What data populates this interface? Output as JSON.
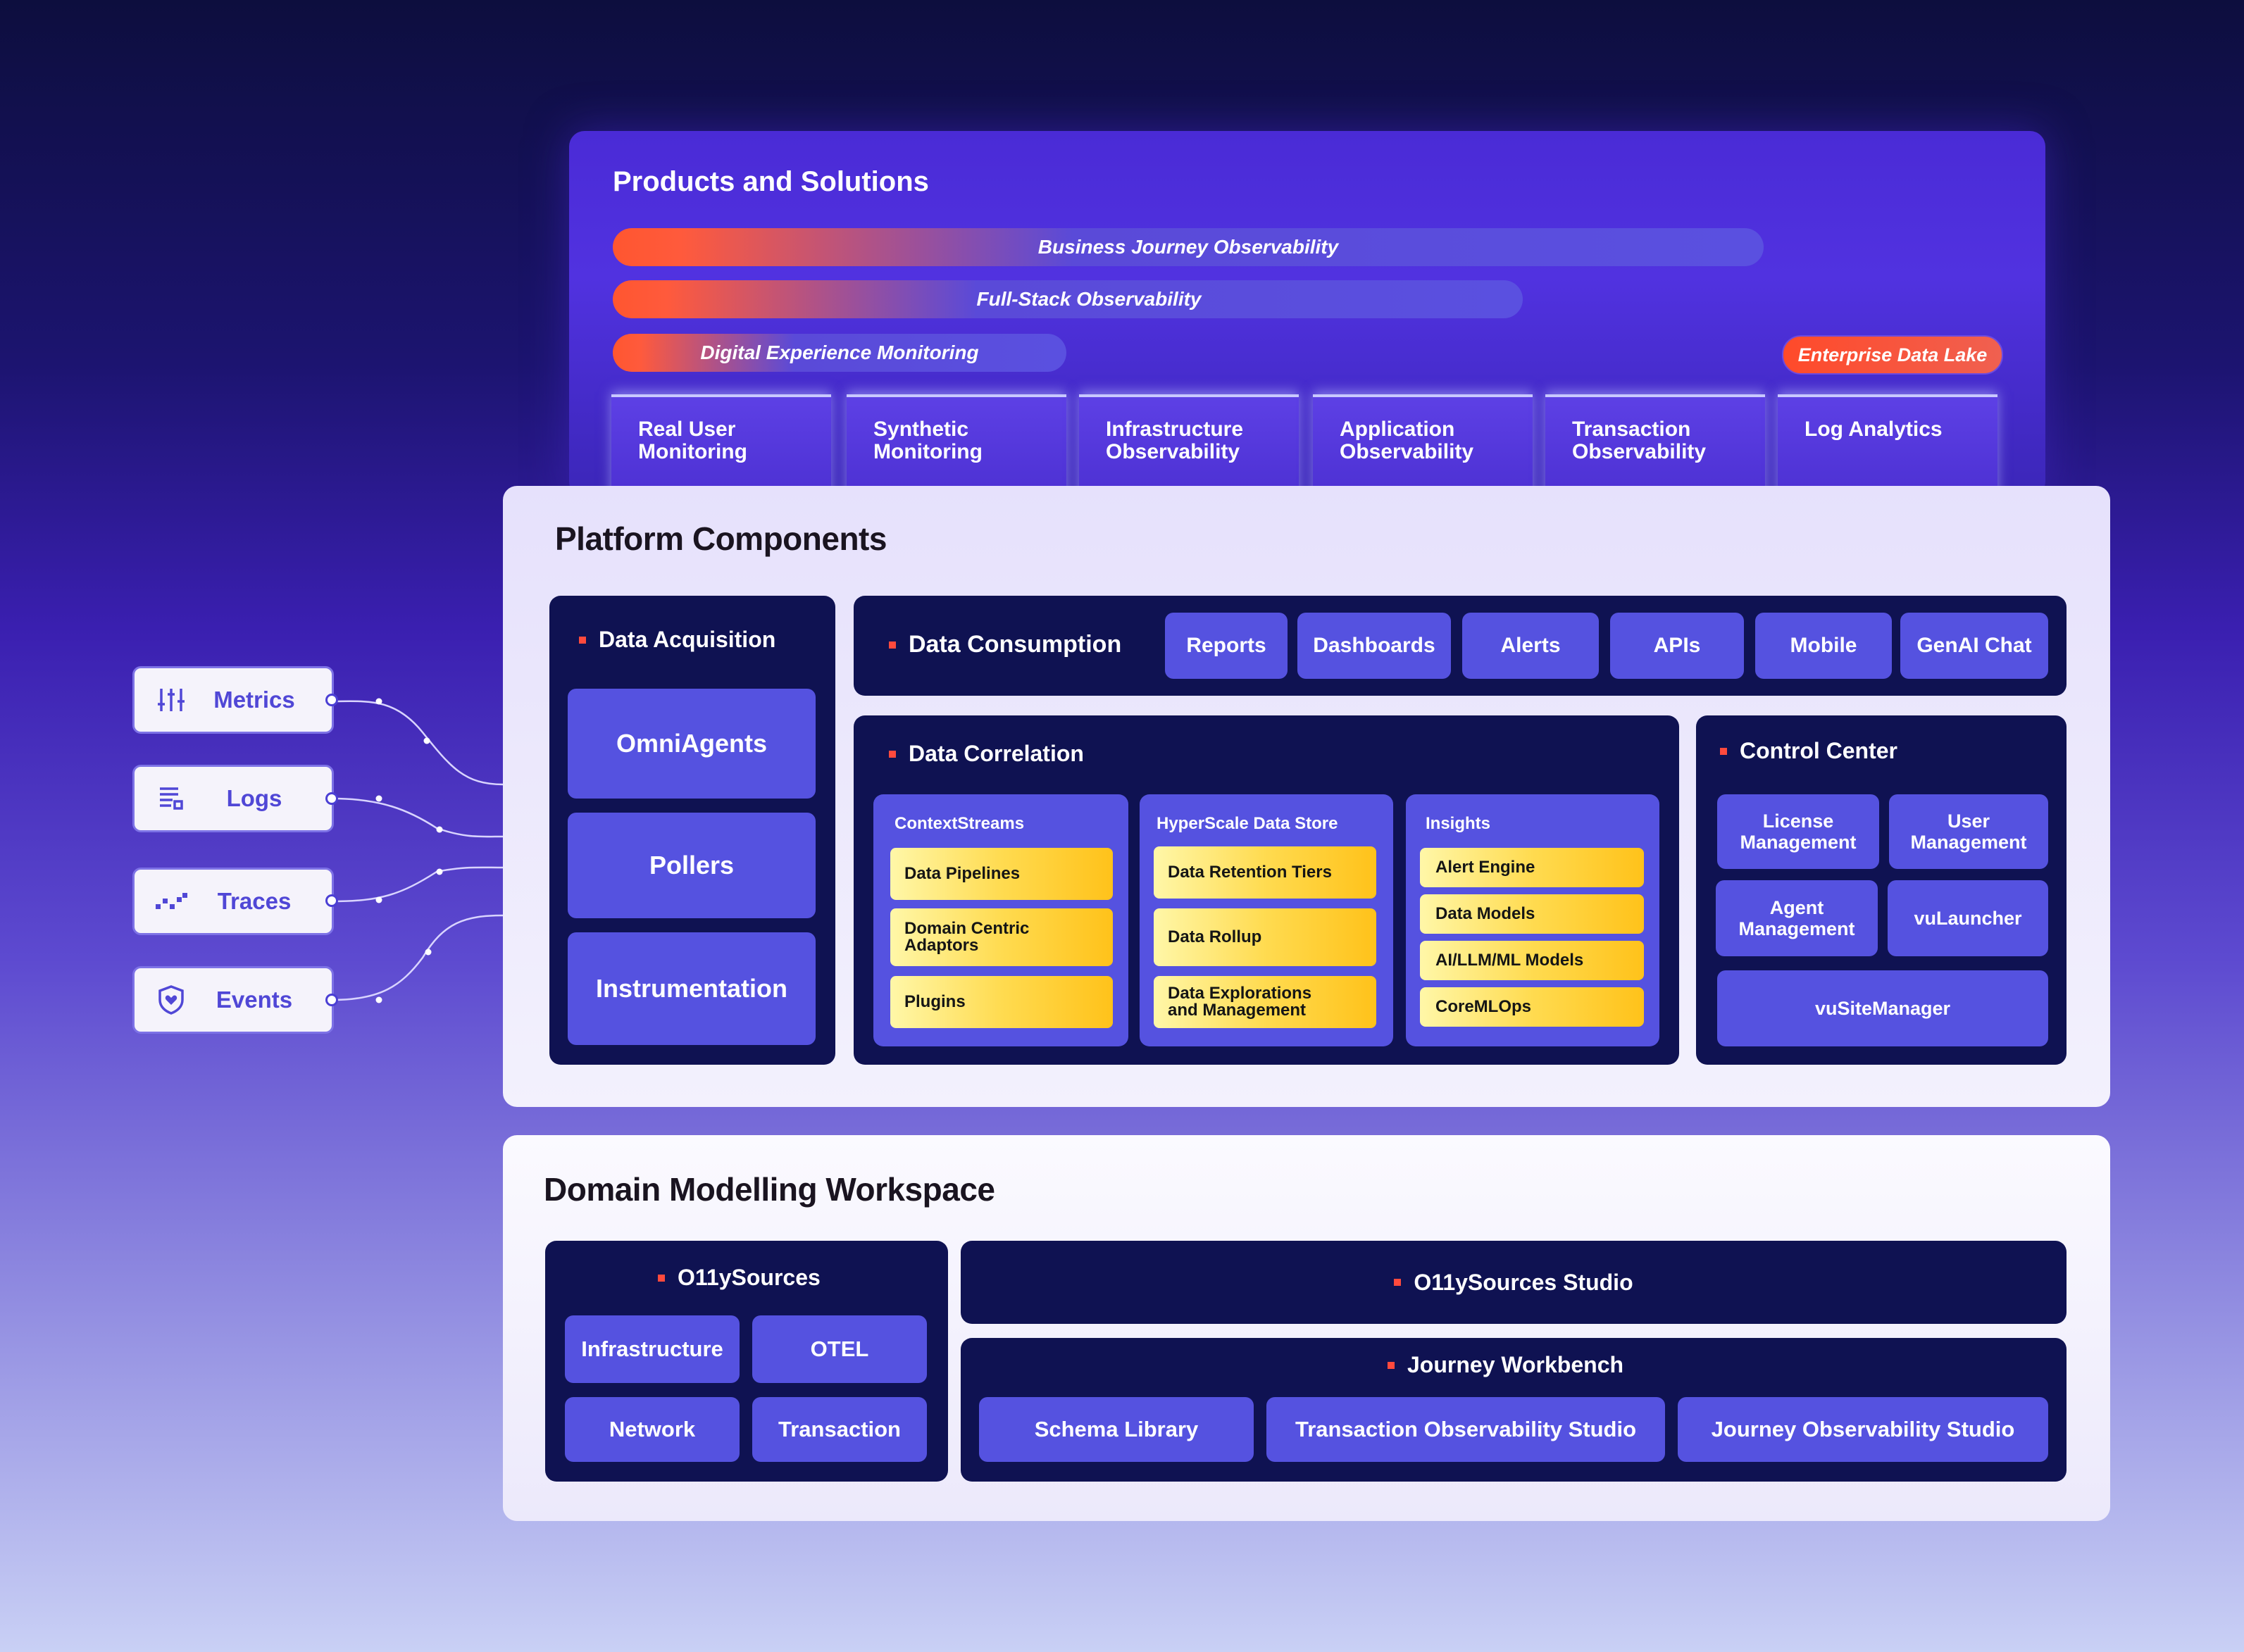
{
  "products": {
    "title": "Products and Solutions",
    "bars": [
      "Business Journey Observability",
      "Full-Stack Observability",
      "Digital Experience Monitoring"
    ],
    "edl": "Enterprise Data Lake",
    "columns": [
      [
        "Real User",
        "Monitoring"
      ],
      [
        "Synthetic",
        "Monitoring"
      ],
      [
        "Infrastructure",
        "Observability"
      ],
      [
        "Application",
        "Observability"
      ],
      [
        "Transaction",
        "Observability"
      ],
      [
        "Log Analytics",
        ""
      ]
    ]
  },
  "platform": {
    "title": "Platform Components",
    "acquisition": {
      "title": "Data Acquisition",
      "items": [
        "OmniAgents",
        "Pollers",
        "Instrumentation"
      ]
    },
    "consumption": {
      "title": "Data Consumption",
      "items": [
        "Reports",
        "Dashboards",
        "Alerts",
        "APIs",
        "Mobile",
        "GenAI Chat"
      ]
    },
    "correlation": {
      "title": "Data Correlation",
      "groups": [
        {
          "title": "ContextStreams",
          "items": [
            [
              "Data Pipelines"
            ],
            [
              "Domain Centric",
              "Adaptors"
            ],
            [
              "Plugins"
            ]
          ]
        },
        {
          "title": "HyperScale Data Store",
          "items": [
            [
              "Data Retention Tiers"
            ],
            [
              "Data Rollup"
            ],
            [
              "Data Explorations",
              "and Management"
            ]
          ]
        },
        {
          "title": "Insights",
          "items": [
            [
              "Alert Engine"
            ],
            [
              "Data Models"
            ],
            [
              "AI/LLM/ML Models"
            ],
            [
              "CoreMLOps"
            ]
          ]
        }
      ]
    },
    "control": {
      "title": "Control Center",
      "items": [
        [
          "License",
          "Management"
        ],
        [
          "User",
          "Management"
        ],
        [
          "Agent",
          "Management"
        ],
        [
          "vuLauncher"
        ],
        [
          "vuSiteManager"
        ]
      ]
    }
  },
  "sources": [
    {
      "label": "Metrics",
      "icon": "sliders-icon"
    },
    {
      "label": "Logs",
      "icon": "log-list-icon"
    },
    {
      "label": "Traces",
      "icon": "trace-icon"
    },
    {
      "label": "Events",
      "icon": "shield-heart-icon"
    }
  ],
  "workspace": {
    "title": "Domain Modelling Workspace",
    "sources": {
      "title": "O11ySources",
      "items": [
        "Infrastructure",
        "OTEL",
        "Network",
        "Transaction"
      ]
    },
    "studio": {
      "title": "O11ySources Studio"
    },
    "journey": {
      "title": "Journey Workbench",
      "items": [
        "Schema Library",
        "Transaction Observability Studio",
        "Journey Observability Studio"
      ]
    }
  },
  "colors": {
    "accent_orange": "#ff4a3d",
    "navy": "#0f1252",
    "button_purple": "#5552e0",
    "yellow_end": "#ffc21a"
  }
}
